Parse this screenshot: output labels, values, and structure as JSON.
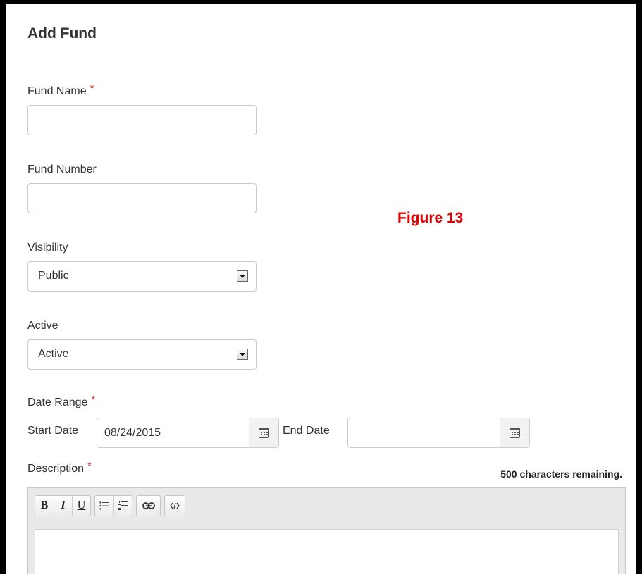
{
  "form": {
    "title": "Add Fund",
    "fund_name": {
      "label": "Fund Name",
      "required_mark": "*",
      "value": ""
    },
    "fund_number": {
      "label": "Fund Number",
      "value": ""
    },
    "visibility": {
      "label": "Visibility",
      "selected": "Public"
    },
    "active": {
      "label": "Active",
      "selected": "Active"
    },
    "date_range": {
      "label": "Date Range",
      "required_mark": "*",
      "start_label": "Start Date",
      "start_value": "08/24/2015",
      "end_label": "End Date",
      "end_value": ""
    },
    "description": {
      "label": "Description",
      "required_mark": "*",
      "remaining": "500 characters remaining."
    }
  },
  "annotation": {
    "figure_label": "Figure 13"
  },
  "toolbar": {
    "bold": "B",
    "italic": "I",
    "underline": "U",
    "icons": [
      "bullet-list-icon",
      "numbered-list-icon",
      "link-icon",
      "code-icon"
    ]
  },
  "colors": {
    "required": "#e0302e",
    "figure_label": "#e00000",
    "frame": "#000000"
  }
}
